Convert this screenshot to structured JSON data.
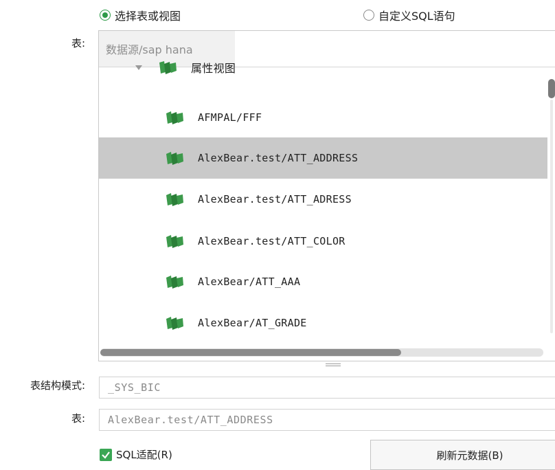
{
  "source_mode": {
    "option_table": {
      "label": "选择表或视图",
      "selected": true
    },
    "option_sql": {
      "label": "自定义SQL语句",
      "selected": false
    }
  },
  "table_label": "表:",
  "search": {
    "value": "数据源/sap hana"
  },
  "tree": {
    "group": {
      "label": "属性视图",
      "expanded": true
    },
    "items": [
      {
        "label": "AFMPAL/FFF",
        "selected": false
      },
      {
        "label": "AlexBear.test/ATT_ADDRESS",
        "selected": true
      },
      {
        "label": "AlexBear.test/ATT_ADRESS",
        "selected": false
      },
      {
        "label": "AlexBear.test/ATT_COLOR",
        "selected": false
      },
      {
        "label": "AlexBear/ATT_AAA",
        "selected": false
      },
      {
        "label": "AlexBear/AT_GRADE",
        "selected": false
      }
    ]
  },
  "schema": {
    "label": "表结构模式:",
    "value": "_SYS_BIC"
  },
  "table_field": {
    "label": "表:",
    "value": "AlexBear.test/ATT_ADDRESS"
  },
  "sql_adapt": {
    "label": "SQL适配(R)",
    "checked": true
  },
  "refresh_button": {
    "label": "刷新元数据(B)"
  },
  "colors": {
    "accent": "#2e9a48",
    "icon_green": "#2f8f3e",
    "selection": "#c9c9c9"
  }
}
